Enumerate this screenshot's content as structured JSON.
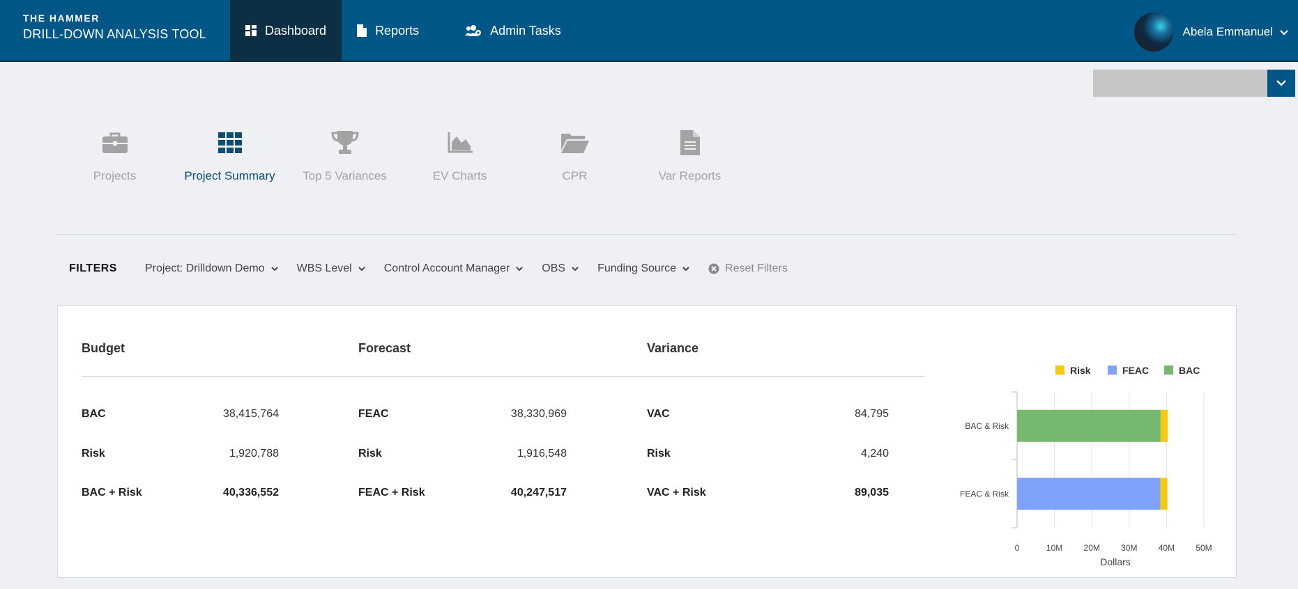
{
  "brand": {
    "top": "THE HAMMER",
    "bottom": "DRILL-DOWN ANALYSIS TOOL"
  },
  "nav": [
    {
      "label": "Dashboard",
      "icon": "dashboard-grid-icon",
      "active": true
    },
    {
      "label": "Reports",
      "icon": "file-icon",
      "active": false
    },
    {
      "label": "Admin Tasks",
      "icon": "users-cog-icon",
      "active": false
    }
  ],
  "user": {
    "name": "Abela Emmanuel"
  },
  "tools": [
    {
      "label": "Projects",
      "icon": "briefcase-icon",
      "active": false
    },
    {
      "label": "Project Summary",
      "icon": "grid-icon",
      "active": true
    },
    {
      "label": "Top 5 Variances",
      "icon": "trophy-icon",
      "active": false
    },
    {
      "label": "EV Charts",
      "icon": "area-chart-icon",
      "active": false
    },
    {
      "label": "CPR",
      "icon": "folder-open-icon",
      "active": false
    },
    {
      "label": "Var Reports",
      "icon": "document-icon",
      "active": false
    }
  ],
  "filters": {
    "label": "FILTERS",
    "items": [
      "Project: Drilldown Demo",
      "WBS Level",
      "Control Account Manager",
      "OBS",
      "Funding Source"
    ],
    "reset": "Reset Filters"
  },
  "summary": {
    "budget": {
      "title": "Budget",
      "rows": [
        {
          "label": "BAC",
          "value": "38,415,764"
        },
        {
          "label": "Risk",
          "value": "1,920,788"
        },
        {
          "label": "BAC + Risk",
          "value": "40,336,552"
        }
      ]
    },
    "forecast": {
      "title": "Forecast",
      "rows": [
        {
          "label": "FEAC",
          "value": "38,330,969"
        },
        {
          "label": "Risk",
          "value": "1,916,548"
        },
        {
          "label": "FEAC + Risk",
          "value": "40,247,517"
        }
      ]
    },
    "variance": {
      "title": "Variance",
      "rows": [
        {
          "label": "VAC",
          "value": "84,795"
        },
        {
          "label": "Risk",
          "value": "4,240"
        },
        {
          "label": "VAC + Risk",
          "value": "89,035"
        }
      ]
    }
  },
  "chart_data": {
    "type": "bar",
    "orientation": "horizontal",
    "stacked": true,
    "categories": [
      "BAC & Risk",
      "FEAC & Risk"
    ],
    "series": [
      {
        "name": "BAC",
        "color": "#76b86e",
        "values": [
          38415764,
          0
        ]
      },
      {
        "name": "FEAC",
        "color": "#7fa2fb",
        "values": [
          0,
          38330969
        ]
      },
      {
        "name": "Risk",
        "color": "#f7ca12",
        "values": [
          1920788,
          1916548
        ]
      }
    ],
    "legend": [
      "Risk",
      "FEAC",
      "BAC"
    ],
    "legend_position": "top-right",
    "xlabel": "Dollars",
    "xlim": [
      0,
      50000000
    ],
    "xticks": [
      "0",
      "10M",
      "20M",
      "30M",
      "40M",
      "50M"
    ],
    "grid": true
  }
}
